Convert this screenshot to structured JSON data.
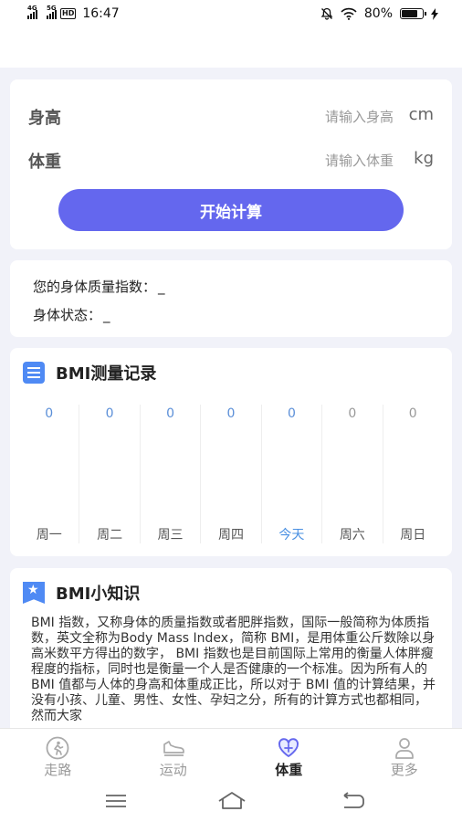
{
  "status": {
    "net1": "4G",
    "net2": "5G",
    "hd": "HD",
    "time": "16:47",
    "battery_pct": "80%",
    "battery_level": 0.8
  },
  "colors": {
    "accent": "#6467ee",
    "icon_blue": "#4f8af4",
    "value_blue": "#5b8fd8"
  },
  "form": {
    "height_label": "身高",
    "height_placeholder": "请输入身高",
    "height_unit": "cm",
    "weight_label": "体重",
    "weight_placeholder": "请输入体重",
    "weight_unit": "kg",
    "calc_button": "开始计算"
  },
  "result": {
    "bmi_label": "您的身体质量指数：",
    "bmi_value": "_",
    "state_label": "身体状态：",
    "state_value": "_"
  },
  "record": {
    "icon": "list-icon",
    "title": "BMI测量记录",
    "days": [
      {
        "name": "周一",
        "value": "0",
        "highlight": true,
        "today": false
      },
      {
        "name": "周二",
        "value": "0",
        "highlight": true,
        "today": false
      },
      {
        "name": "周三",
        "value": "0",
        "highlight": true,
        "today": false
      },
      {
        "name": "周四",
        "value": "0",
        "highlight": true,
        "today": false
      },
      {
        "name": "今天",
        "value": "0",
        "highlight": true,
        "today": true
      },
      {
        "name": "周六",
        "value": "0",
        "highlight": false,
        "today": false
      },
      {
        "name": "周日",
        "value": "0",
        "highlight": false,
        "today": false
      }
    ]
  },
  "knowledge": {
    "icon": "bookmark-star-icon",
    "title": "BMI小知识",
    "text": "BMI 指数，又称身体的质量指数或者肥胖指数，国际一般简称为体质指数，英文全称为Body Mass Index，简称 BMI，是用体重公斤数除以身高米数平方得出的数字， BMI 指数也是目前国际上常用的衡量人体胖瘦程度的指标，同时也是衡量一个人是否健康的一个标准。因为所有人的 BMI 值都与人体的身高和体重成正比，所以对于 BMI 值的计算结果，并没有小孩、儿童、男性、女性、孕妇之分，所有的计算方式也都相同，然而大家"
  },
  "tabs": [
    {
      "label": "走路",
      "icon": "walk-icon",
      "active": false
    },
    {
      "label": "运动",
      "icon": "sneaker-icon",
      "active": false
    },
    {
      "label": "体重",
      "icon": "heart-icon",
      "active": true
    },
    {
      "label": "更多",
      "icon": "person-icon",
      "active": false
    }
  ]
}
